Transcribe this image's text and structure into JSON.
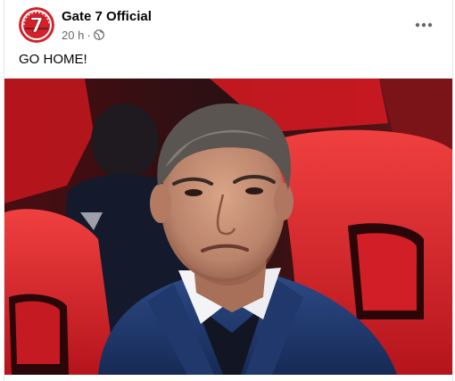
{
  "post": {
    "author": "Gate 7 Official",
    "timestamp": "20 h",
    "separator": "·",
    "audience_icon": "globe-icon",
    "more_icon": "more-options-icon",
    "text": "GO HOME!",
    "avatar_logo_text": "7"
  },
  "photo": {
    "subject": "man in navy blazer and white shirt seated in red stadium seats"
  },
  "colors": {
    "seat_red": "#e3262d",
    "blazer_navy": "#1f3566",
    "avatar_red": "#d3202a"
  }
}
